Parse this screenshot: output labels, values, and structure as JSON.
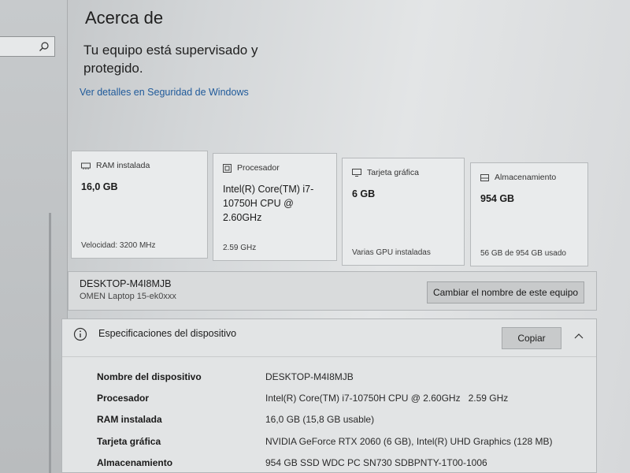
{
  "header": {
    "title": "Acerca de",
    "status_title": "Tu equipo está supervisado y protegido.",
    "security_link": "Ver detalles en Seguridad de Windows"
  },
  "cards": [
    {
      "icon": "ram-icon",
      "label": "RAM instalada",
      "value": "16,0 GB",
      "sub": "Velocidad: 3200 MHz"
    },
    {
      "icon": "processor-icon",
      "label": "Procesador",
      "value": "Intel(R) Core(TM) i7-10750H CPU @ 2.60GHz",
      "sub": "2.59 GHz"
    },
    {
      "icon": "gpu-icon",
      "label": "Tarjeta gráfica",
      "value": "6 GB",
      "sub": "Varias GPU instaladas"
    },
    {
      "icon": "storage-icon",
      "label": "Almacenamiento",
      "value": "954 GB",
      "sub": "56 GB de 954 GB usado"
    }
  ],
  "device": {
    "name": "DESKTOP-M4I8MJB",
    "model": "OMEN Laptop 15-ek0xxx",
    "rename_label": "Cambiar el nombre de este equipo"
  },
  "specs": {
    "title": "Especificaciones del dispositivo",
    "copy_label": "Copiar",
    "rows": [
      {
        "label": "Nombre del dispositivo",
        "value": "DESKTOP-M4I8MJB"
      },
      {
        "label": "Procesador",
        "value": "Intel(R) Core(TM) i7-10750H CPU @ 2.60GHz   2.59 GHz"
      },
      {
        "label": "RAM instalada",
        "value": "16,0 GB (15,8 GB usable)"
      },
      {
        "label": "Tarjeta gráfica",
        "value": "NVIDIA GeForce RTX 2060 (6 GB), Intel(R) UHD Graphics (128 MB)"
      },
      {
        "label": "Almacenamiento",
        "value": "954 GB SSD WDC PC SN730 SDBPNTY-1T00-1006"
      }
    ]
  }
}
